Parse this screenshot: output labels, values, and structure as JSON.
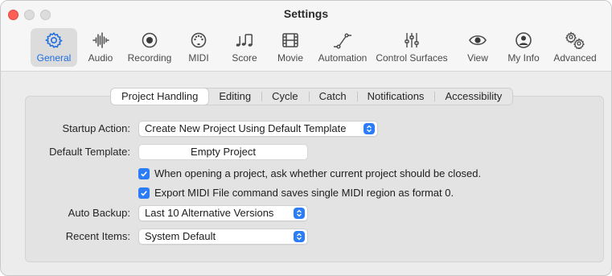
{
  "window": {
    "title": "Settings"
  },
  "toolbar": {
    "items": [
      {
        "label": "General",
        "icon": "gear-icon",
        "selected": true
      },
      {
        "label": "Audio",
        "icon": "waveform-icon"
      },
      {
        "label": "Recording",
        "icon": "record-icon"
      },
      {
        "label": "MIDI",
        "icon": "midi-port-icon"
      },
      {
        "label": "Score",
        "icon": "music-notes-icon"
      },
      {
        "label": "Movie",
        "icon": "film-icon"
      },
      {
        "label": "Automation",
        "icon": "automation-curve-icon"
      },
      {
        "label": "Control Surfaces",
        "icon": "faders-icon"
      },
      {
        "label": "View",
        "icon": "eye-icon"
      },
      {
        "label": "My Info",
        "icon": "person-icon"
      },
      {
        "label": "Advanced",
        "icon": "gears-icon"
      }
    ]
  },
  "tabs": [
    {
      "label": "Project Handling",
      "active": true
    },
    {
      "label": "Editing"
    },
    {
      "label": "Cycle"
    },
    {
      "label": "Catch"
    },
    {
      "label": "Notifications"
    },
    {
      "label": "Accessibility"
    }
  ],
  "form": {
    "startup_action": {
      "label": "Startup Action:",
      "value": "Create New Project Using Default Template"
    },
    "default_template": {
      "label": "Default Template:",
      "value": "Empty Project"
    },
    "checkbox_close": {
      "label": "When opening a project, ask whether current project should be closed.",
      "checked": true
    },
    "checkbox_midi": {
      "label": "Export MIDI File command saves single MIDI region as format 0.",
      "checked": true
    },
    "auto_backup": {
      "label": "Auto Backup:",
      "value": "Last 10 Alternative Versions"
    },
    "recent_items": {
      "label": "Recent Items:",
      "value": "System Default"
    }
  },
  "colors": {
    "accent": "#2b7cf6",
    "selected_label": "#1f6fe0",
    "close_button": "#fe5f57"
  }
}
